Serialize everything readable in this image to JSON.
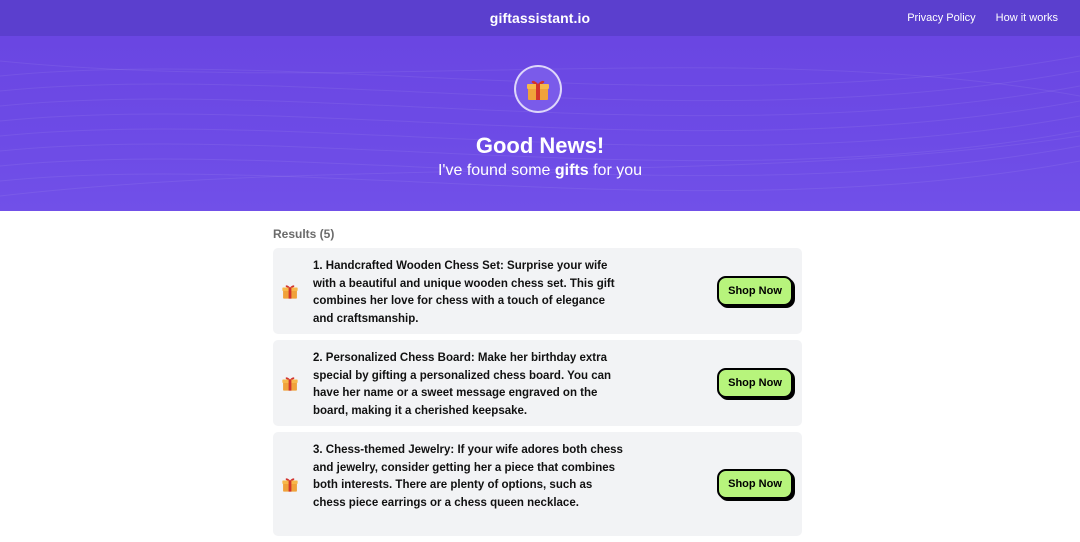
{
  "nav": {
    "brand": "giftassistant.io",
    "links": [
      "Privacy Policy",
      "How it works"
    ]
  },
  "hero": {
    "icon": "gift-icon",
    "title": "Good News!",
    "subtitle_pre": "I've found some ",
    "subtitle_bold": "gifts",
    "subtitle_post": " for you"
  },
  "results": {
    "label": "Results (5)",
    "items": [
      {
        "text": "1. Handcrafted Wooden Chess Set: Surprise your wife with a beautiful and unique wooden chess set. This gift combines her love for chess with a touch of elegance and craftsmanship.",
        "button": "Shop Now"
      },
      {
        "text": "2. Personalized Chess Board: Make her birthday extra special by gifting a personalized chess board. You can have her name or a sweet message engraved on the board, making it a cherished keepsake.",
        "button": "Shop Now"
      },
      {
        "text": "3. Chess-themed Jewelry: If your wife adores both chess and jewelry, consider getting her a piece that combines both interests. There are plenty of options, such as chess piece earrings or a chess queen necklace.",
        "button": "Shop Now"
      }
    ]
  },
  "colors": {
    "nav_bg": "#5b3fce",
    "hero_bg": "#6d4be6",
    "card_bg": "#f2f3f5",
    "button_bg": "#b7f47c"
  }
}
